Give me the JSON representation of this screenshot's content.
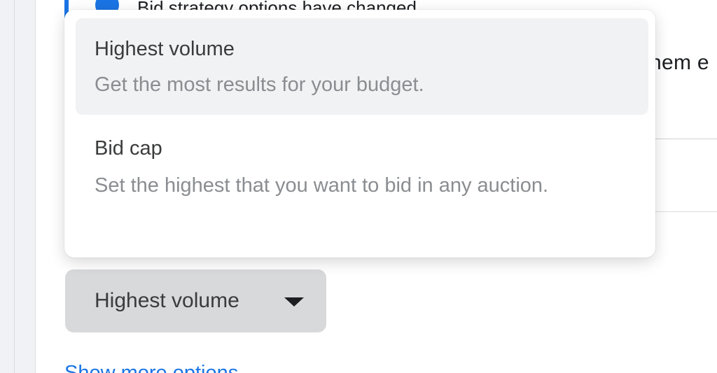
{
  "background": {
    "cut_header_text": "Bid strategy options have changed",
    "right_cut_text": "hem e",
    "bottom_link_text": "Show more options"
  },
  "dropdown": {
    "options": [
      {
        "title": "Highest volume",
        "description": "Get the most results for your budget.",
        "selected": true
      },
      {
        "title": "Bid cap",
        "description": "Set the highest that you want to bid in any auction.",
        "selected": false
      }
    ]
  },
  "select": {
    "value": "Highest volume",
    "icon": "caret-down-icon"
  },
  "colors": {
    "accent": "#1b74e4",
    "selected_option_bg": "#f0f2f3",
    "select_button_bg": "#d8d9db"
  }
}
